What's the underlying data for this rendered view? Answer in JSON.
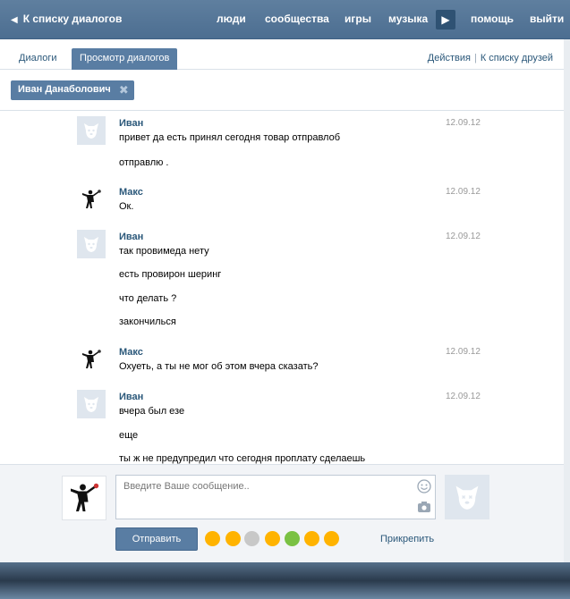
{
  "colors": {
    "accent": "#597da3",
    "link": "#2b587a",
    "topbar": "#5070929"
  },
  "topbar": {
    "back_label": "К списку диалогов",
    "nav": [
      "люди",
      "сообщества",
      "игры",
      "музыка",
      "помощь",
      "выйти"
    ],
    "play_icon": "play-icon"
  },
  "tabs": {
    "dialogs": "Диалоги",
    "view": "Просмотр диалогов",
    "actions": "Действия",
    "sep": "|",
    "to_friends": "К списку друзей"
  },
  "chip": {
    "label": "Иван Данаболович",
    "close": "✖"
  },
  "messages": [
    {
      "author": "Иван",
      "date": "12.09.12",
      "lines": [
        "привет да есть принял сегодня товар отправлоб",
        "отправлю ."
      ]
    },
    {
      "author": "Макс",
      "date": "12.09.12",
      "lines": [
        "Ок."
      ]
    },
    {
      "author": "Иван",
      "date": "12.09.12",
      "lines": [
        "так провимеда нету",
        "есть провирон шеринг",
        "что делать ?",
        "закончилься"
      ]
    },
    {
      "author": "Макс",
      "date": "12.09.12",
      "lines": [
        "Охуеть, а ты не мог об этом вчера сказать?"
      ]
    },
    {
      "author": "Иван",
      "date": "12.09.12",
      "lines": [
        "вчера был езе",
        "еще",
        "ты ж не предупредил что сегодня проплату сделаешь"
      ]
    }
  ],
  "composer": {
    "placeholder": "Введите Ваше сообщение..",
    "send": "Отправить",
    "attach": "Прикрепить"
  }
}
